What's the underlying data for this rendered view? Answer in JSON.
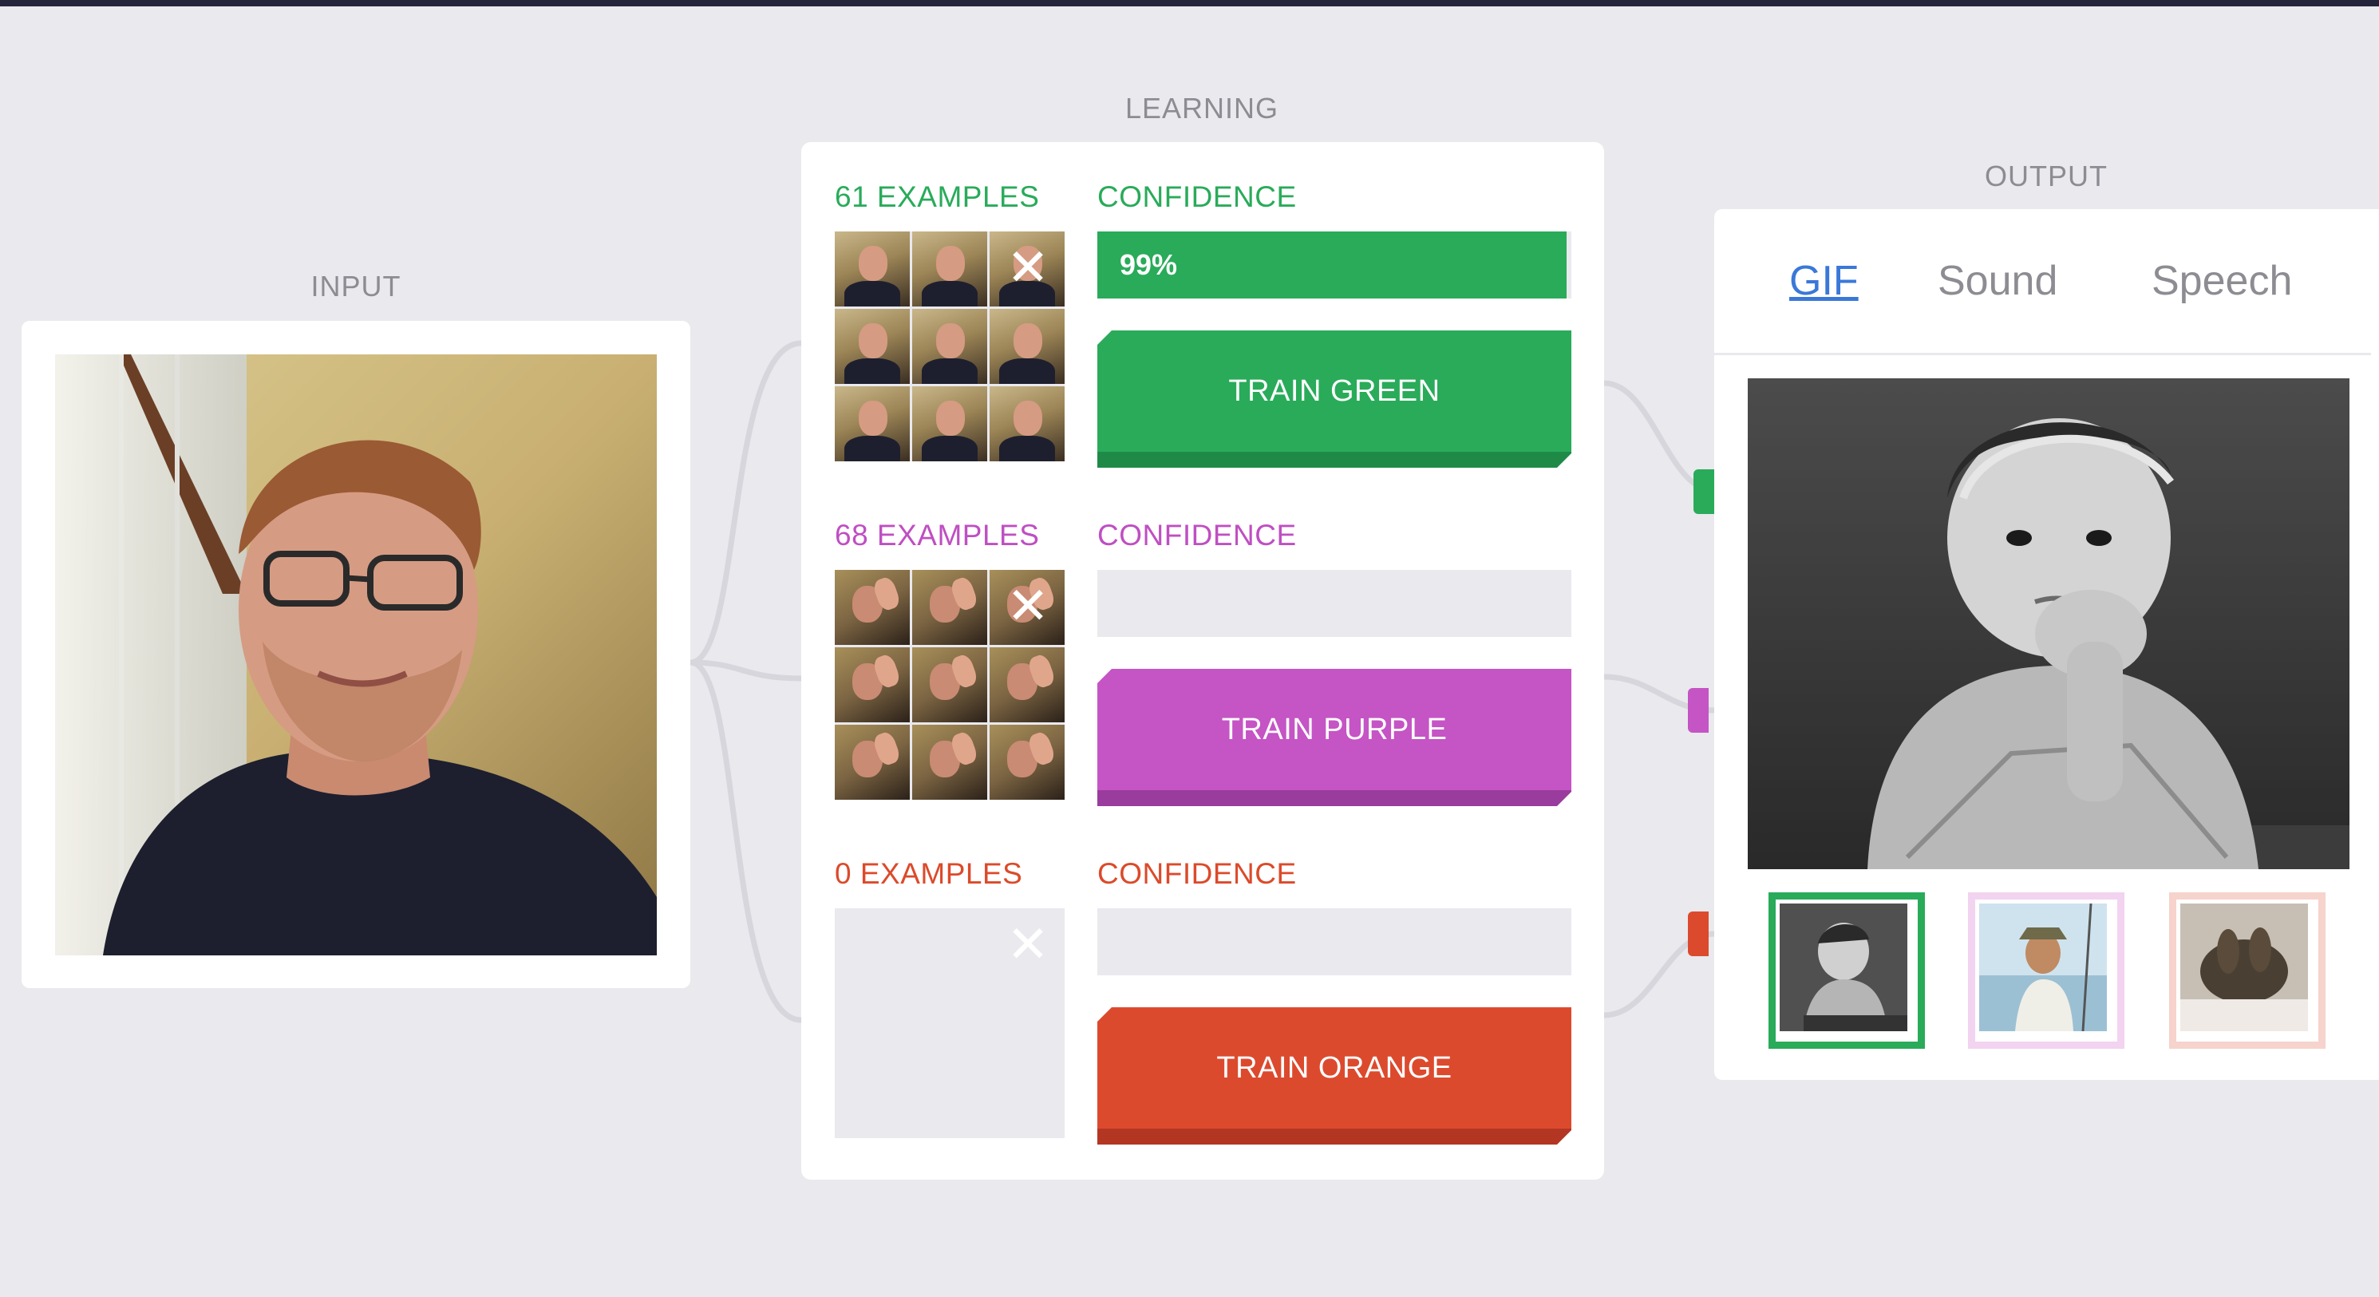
{
  "sections": {
    "input_title": "INPUT",
    "learning_title": "LEARNING",
    "output_title": "OUTPUT"
  },
  "classes": [
    {
      "examples_label": "61 EXAMPLES",
      "confidence_label": "CONFIDENCE",
      "confidence_value": "99%",
      "confidence_fraction": 0.99,
      "train_label": "TRAIN GREEN",
      "color": "#29ab5a",
      "button_color": "#29ab5a",
      "button_shadow": "#1f8a47",
      "thumb_style": "face",
      "thumb_count": 9
    },
    {
      "examples_label": "68 EXAMPLES",
      "confidence_label": "CONFIDENCE",
      "confidence_value": "",
      "confidence_fraction": 0,
      "train_label": "TRAIN PURPLE",
      "color": "#bf4fc2",
      "button_color": "#c554c5",
      "button_shadow": "#9a3c9d",
      "thumb_style": "hand",
      "thumb_count": 9
    },
    {
      "examples_label": "0 EXAMPLES",
      "confidence_label": "CONFIDENCE",
      "confidence_value": "",
      "confidence_fraction": 0,
      "train_label": "TRAIN ORANGE",
      "color": "#dc4a2a",
      "button_color": "#dc4a2e",
      "button_shadow": "#b33623",
      "thumb_style": "empty",
      "thumb_count": 0
    }
  ],
  "output": {
    "tabs": [
      {
        "label": "GIF",
        "active": true
      },
      {
        "label": "Sound",
        "active": false
      },
      {
        "label": "Speech",
        "active": false
      }
    ],
    "gif_thumbs": [
      {
        "border_color": "#29ab5a",
        "selected": true
      },
      {
        "border_color": "#f2d3f0",
        "selected": false
      },
      {
        "border_color": "#f6d3cc",
        "selected": false
      }
    ]
  },
  "icons": {
    "remove": "close-icon"
  }
}
